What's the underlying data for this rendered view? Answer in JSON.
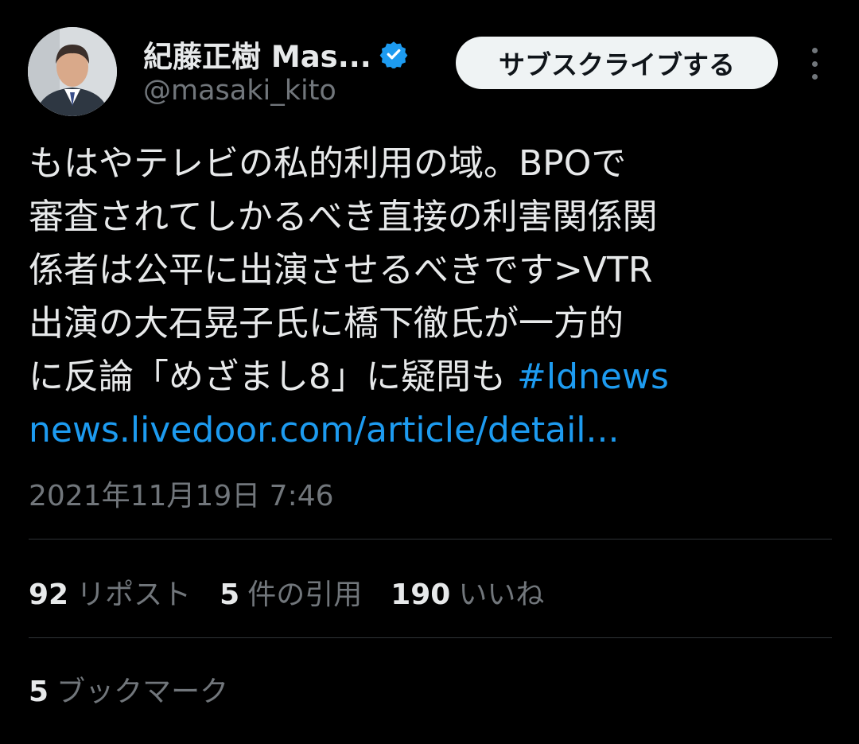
{
  "header": {
    "display_name": "紀藤正樹 Mas...",
    "handle": "@masaki_kito",
    "subscribe_label": "サブスクライブする",
    "verified_icon": "verified-badge-icon",
    "more_icon": "more-vertical-icon"
  },
  "tweet": {
    "lines": [
      "もはやテレビの私的利用の域。BPOで",
      "審査されてしかるべき直接の利害関係関",
      "係者は公平に出演させるべきです>VTR",
      "出演の大石晃子氏に橋下徹氏が一方的"
    ],
    "last_line_text": "に反論「めざまし8」に疑問も ",
    "hashtag": "#ldnews",
    "url": "news.livedoor.com/article/detail..."
  },
  "timestamp": "2021年11月19日 7:46",
  "stats": {
    "reposts": {
      "count": "92",
      "label": "リポスト"
    },
    "quotes": {
      "count": "5",
      "label": "件の引用"
    },
    "likes": {
      "count": "190",
      "label": "いいね"
    }
  },
  "bookmarks": {
    "count": "5",
    "label": "ブックマーク"
  },
  "colors": {
    "background": "#000000",
    "text": "#e7e9ea",
    "secondary": "#71767b",
    "link": "#1d9bf0",
    "verified": "#1d9bf0",
    "divider": "#2f3336"
  }
}
